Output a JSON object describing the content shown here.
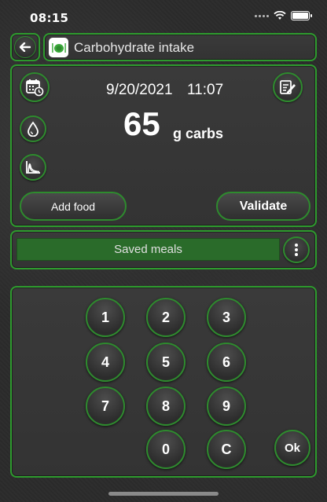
{
  "status": {
    "time": "08:15"
  },
  "header": {
    "title": "Carbohydrate intake"
  },
  "entry": {
    "date": "9/20/2021",
    "time": "11:07",
    "amount": "65",
    "unit": "g carbs",
    "add_food_label": "Add food",
    "validate_label": "Validate"
  },
  "meals": {
    "saved_meals_label": "Saved meals"
  },
  "keypad": {
    "keys": [
      "1",
      "2",
      "3",
      "4",
      "5",
      "6",
      "7",
      "8",
      "9",
      "0",
      "C"
    ],
    "ok_label": "Ok"
  },
  "colors": {
    "accent_green": "#2e9b2e",
    "bar_green": "#2a6b2a"
  }
}
